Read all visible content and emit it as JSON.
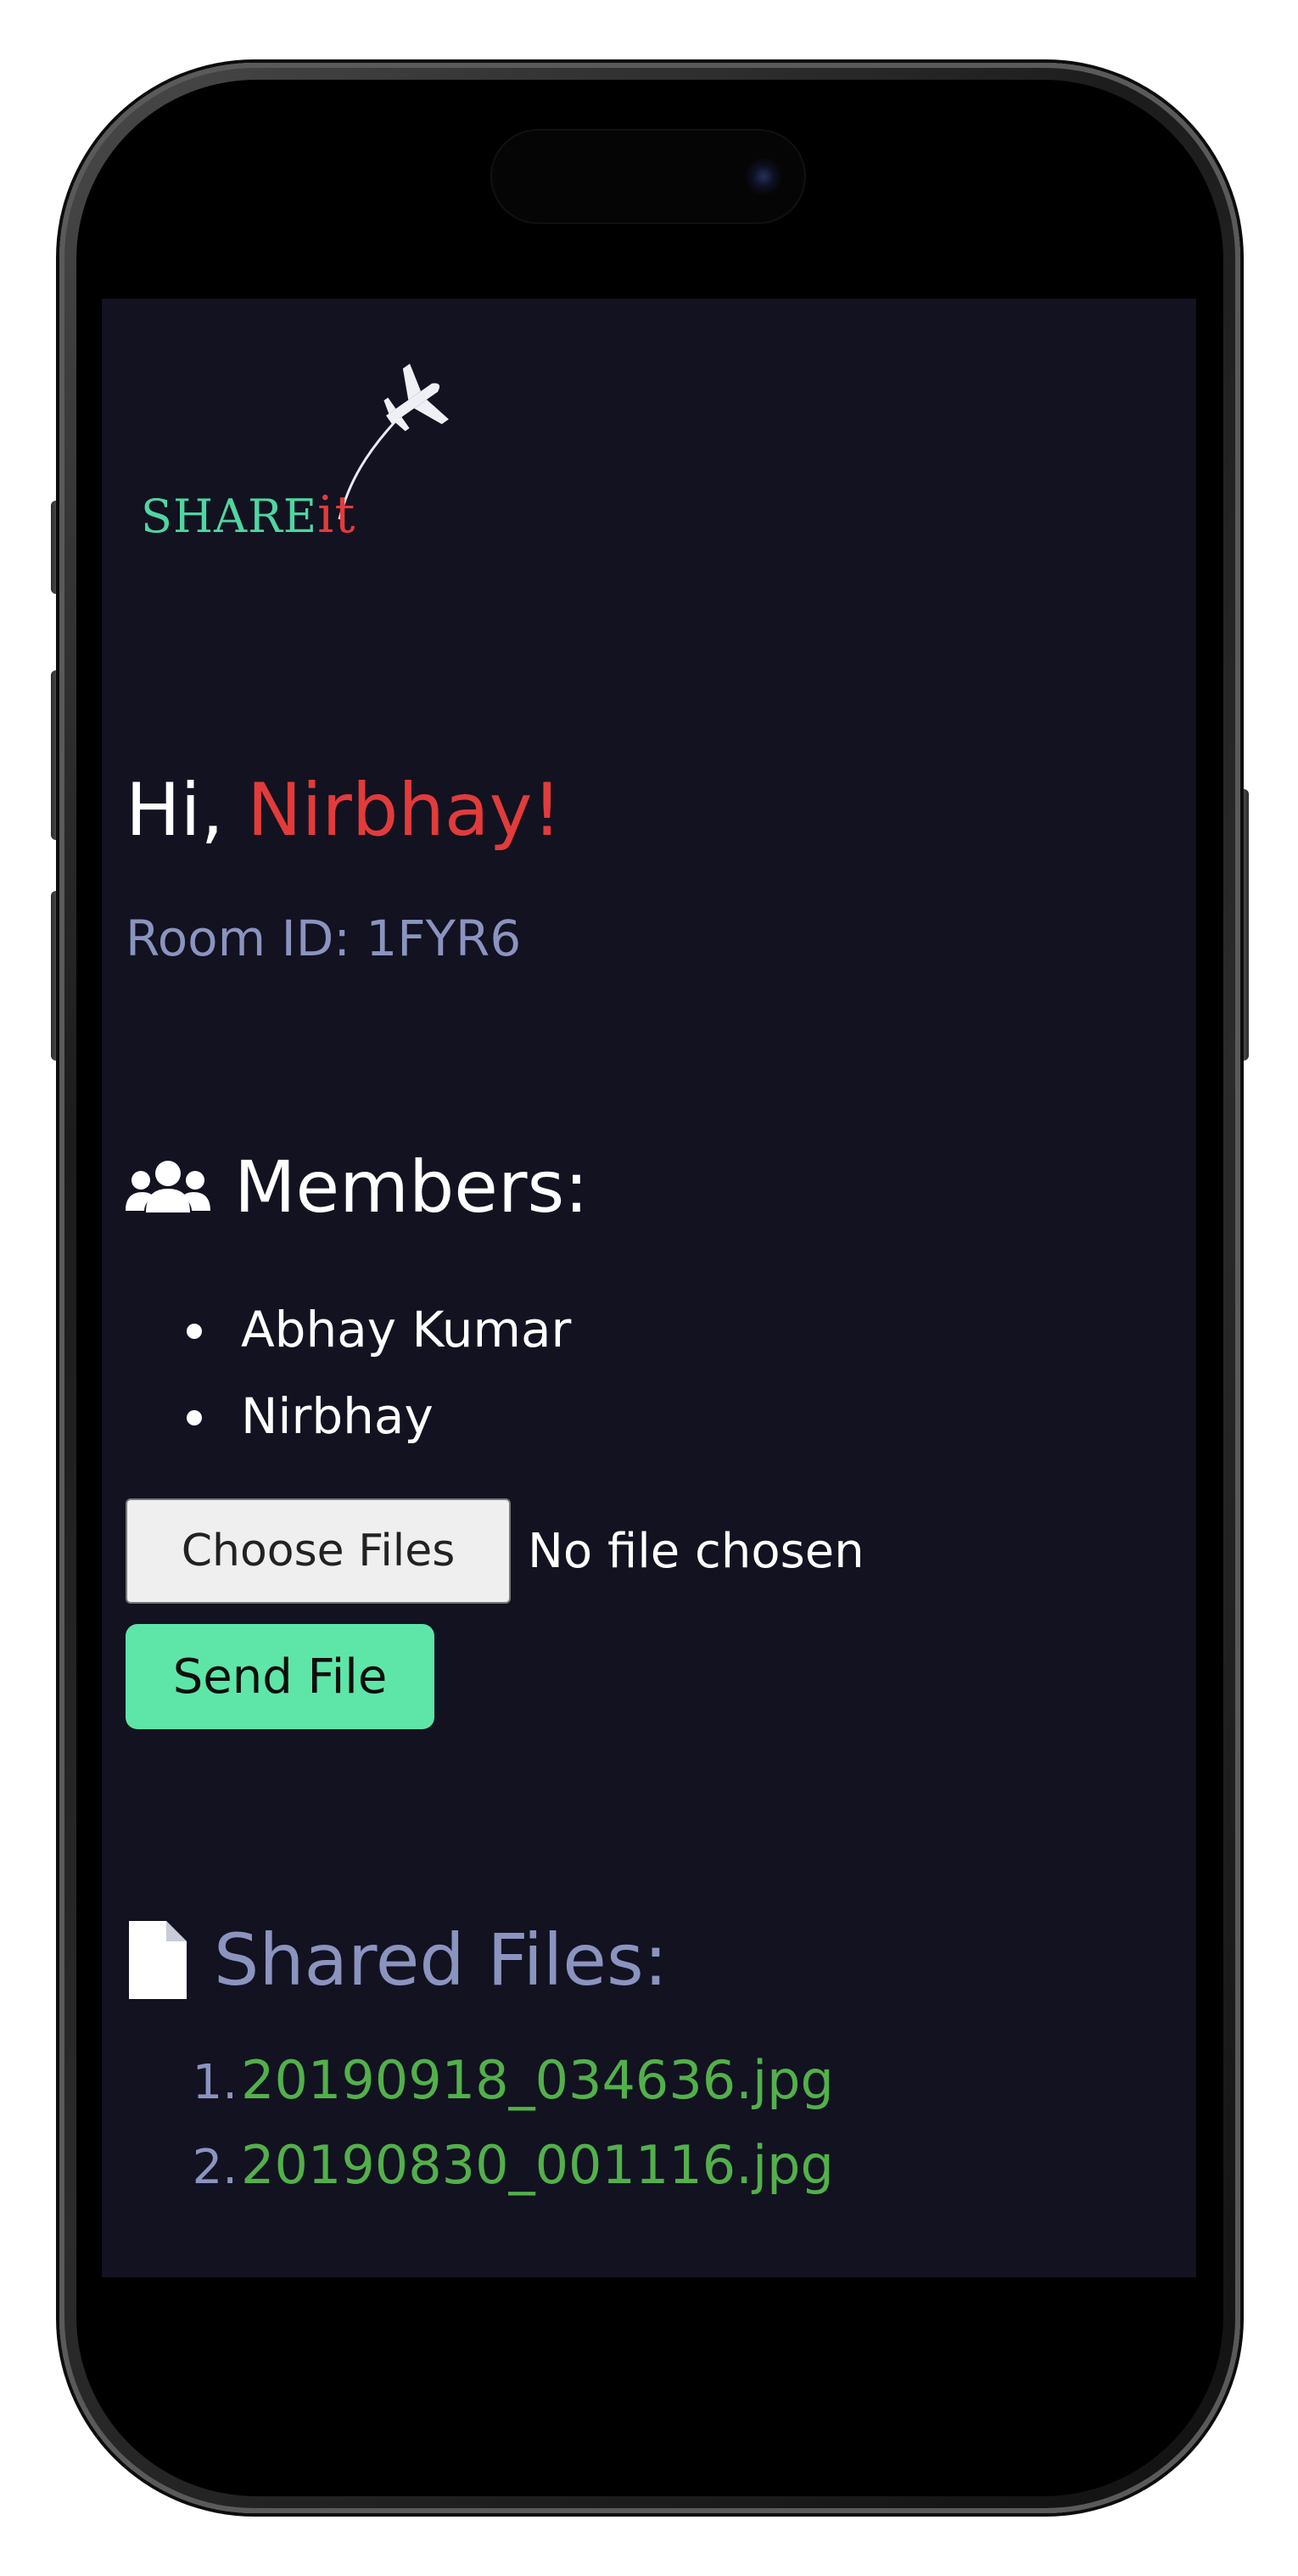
{
  "app": {
    "logo_share": "SHARE",
    "logo_it": "it"
  },
  "greeting": {
    "prefix": "Hi, ",
    "name": "Nirbhay!"
  },
  "room": {
    "label": "Room ID: 1FYR6"
  },
  "members": {
    "title": "Members:",
    "icon": "users-icon",
    "items": [
      "Abhay Kumar",
      "Nirbhay"
    ]
  },
  "upload": {
    "choose_label": "Choose Files",
    "status": "No file chosen",
    "send_label": "Send File"
  },
  "shared": {
    "title": "Shared Files:",
    "icon": "file-icon",
    "items": [
      {
        "num": "1.",
        "name": "20190918_034636.jpg"
      },
      {
        "num": "2.",
        "name": "20190830_001116.jpg"
      }
    ]
  },
  "colors": {
    "background": "#121221",
    "accent_red": "#e23b3b",
    "muted": "#8b94bf",
    "send_button": "#5de6a8",
    "file_link": "#52b04a",
    "logo_green": "#4fd6a0"
  }
}
